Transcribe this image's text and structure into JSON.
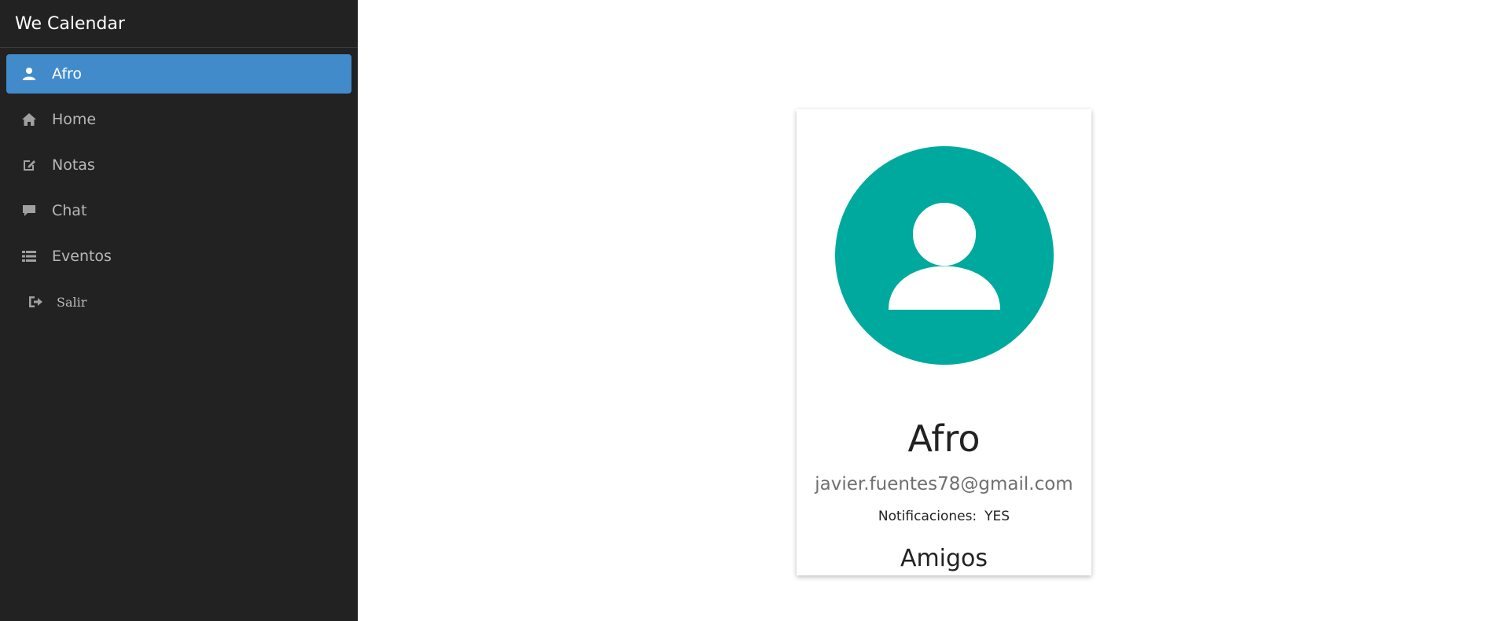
{
  "app": {
    "title": "We Calendar"
  },
  "sidebar": {
    "items": [
      {
        "label": "Afro",
        "icon": "user-icon",
        "active": true
      },
      {
        "label": "Home",
        "icon": "home-icon",
        "active": false
      },
      {
        "label": "Notas",
        "icon": "edit-icon",
        "active": false
      },
      {
        "label": "Chat",
        "icon": "comment-icon",
        "active": false
      },
      {
        "label": "Eventos",
        "icon": "list-icon",
        "active": false
      }
    ],
    "logout": {
      "label": "Salir",
      "icon": "sign-out-icon"
    }
  },
  "profile": {
    "avatar_icon": "user-avatar-icon",
    "name": "Afro",
    "email": "javier.fuentes78@gmail.com",
    "notifications_label": "Notificaciones:",
    "notifications_value": "YES",
    "friends_heading": "Amigos"
  },
  "colors": {
    "sidebar_bg": "#222222",
    "active_item": "#428bca",
    "avatar_bg": "#00a99d"
  }
}
